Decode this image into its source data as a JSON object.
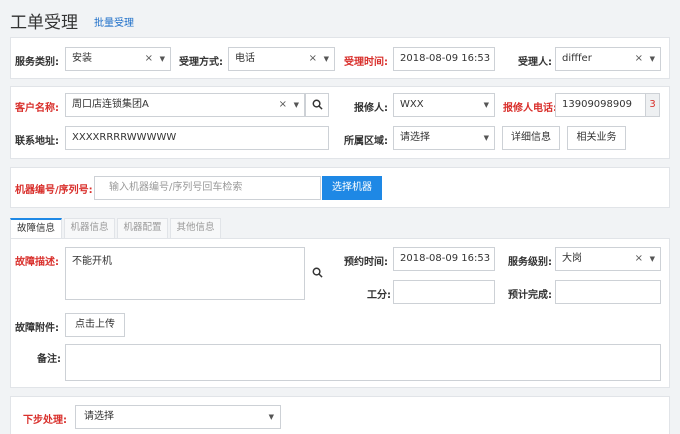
{
  "header": {
    "title": "工单受理",
    "batch_link": "批量受理"
  },
  "row1": {
    "service_type": {
      "label": "服务类别:",
      "value": "安装"
    },
    "accept_method": {
      "label": "受理方式:",
      "value": "电话"
    },
    "accept_time": {
      "label": "受理时间:",
      "value": "2018-08-09 16:53"
    },
    "acceptor": {
      "label": "受理人:",
      "value": "difffer"
    }
  },
  "customer": {
    "name_label": "客户名称:",
    "name_value": "周口店连锁集团A",
    "reporter_label": "报修人:",
    "reporter_value": "WXX",
    "phone_label": "报修人电话:",
    "phone_value": "13909098909",
    "phone_badge": "3",
    "address_label": "联系地址:",
    "address_value": "XXXXRRRRWWWWW",
    "region_label": "所属区域:",
    "region_value": "请选择",
    "detail_button": "详细信息",
    "related_button": "相关业务"
  },
  "machine": {
    "label": "机器编号/序列号:",
    "placeholder": "输入机器编号/序列号回车检索",
    "select_button": "选择机器"
  },
  "tabs": [
    "故障信息",
    "机器信息",
    "机器配置",
    "其他信息"
  ],
  "fault": {
    "desc_label": "故障描述:",
    "desc_value": "不能开机",
    "appt_label": "预约时间:",
    "appt_value": "2018-08-09 16:53",
    "level_label": "服务级别:",
    "level_value": "大岗",
    "hours_label": "工分:",
    "hours_value": "",
    "expected_label": "预计完成:",
    "expected_value": "",
    "attach_label": "故障附件:",
    "upload_button": "点击上传",
    "remark_label": "备注:",
    "remark_value": ""
  },
  "next": {
    "label": "下步处理:",
    "value": "请选择"
  },
  "glyphs": {
    "clear": "×",
    "arrow": "▼",
    "search": "⚲"
  }
}
